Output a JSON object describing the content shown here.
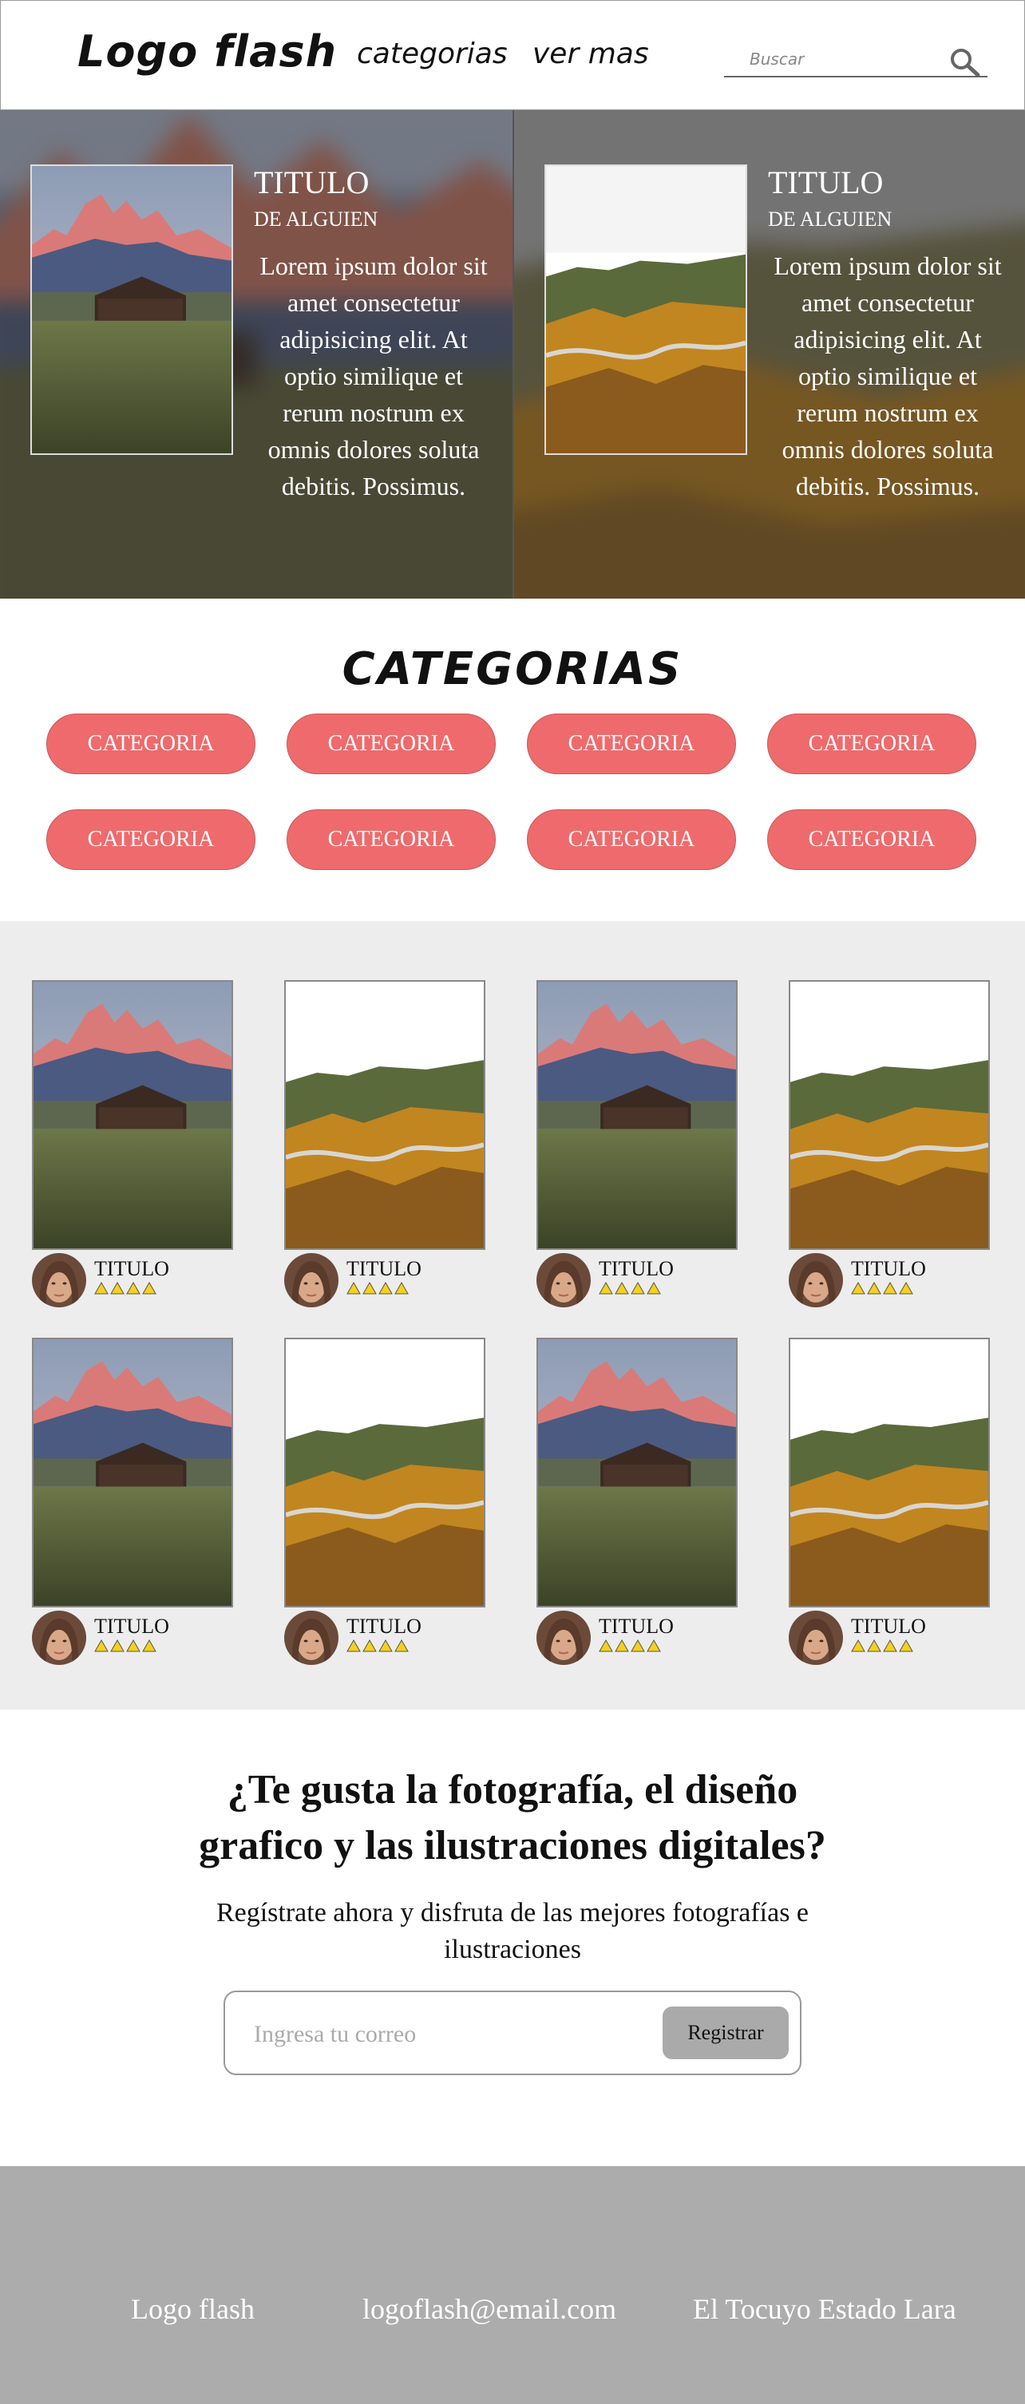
{
  "header": {
    "logo": "Logo flash",
    "nav": [
      "categorias",
      "ver mas"
    ],
    "search_placeholder": "Buscar",
    "search_icon": "search-icon"
  },
  "hero": [
    {
      "title": "TITULO",
      "author": "DE ALGUIEN",
      "description": "Lorem ipsum dolor sit amet consectetur adipisicing elit. At optio similique et rerum nostrum ex omnis dolores soluta debitis. Possimus.",
      "image": "mountain-barn"
    },
    {
      "title": "TITULO",
      "author": "DE ALGUIEN",
      "description": "Lorem ipsum dolor sit amet consectetur adipisicing elit. At optio similique et rerum nostrum ex omnis dolores soluta debitis. Possimus.",
      "image": "autumn-valley-road"
    }
  ],
  "categories": {
    "title": "CATEGORIAS",
    "buttons": [
      "CATEGORIA",
      "CATEGORIA",
      "CATEGORIA",
      "CATEGORIA",
      "CATEGORIA",
      "CATEGORIA",
      "CATEGORIA",
      "CATEGORIA"
    ],
    "button_color": "#ef6a6c"
  },
  "gallery": {
    "background": "#ededed",
    "cards": [
      {
        "title": "TITULO",
        "image": "mountain-barn",
        "rating": 4
      },
      {
        "title": "TITULO",
        "image": "autumn-valley-road",
        "rating": 4
      },
      {
        "title": "TITULO",
        "image": "mountain-barn",
        "rating": 4
      },
      {
        "title": "TITULO",
        "image": "autumn-valley-road",
        "rating": 4
      },
      {
        "title": "TITULO",
        "image": "mountain-barn",
        "rating": 4
      },
      {
        "title": "TITULO",
        "image": "autumn-valley-road",
        "rating": 4
      },
      {
        "title": "TITULO",
        "image": "mountain-barn",
        "rating": 4
      },
      {
        "title": "TITULO",
        "image": "autumn-valley-road",
        "rating": 4
      }
    ]
  },
  "signup": {
    "title_line1": "¿Te gusta la fotografía, el diseño",
    "title_line2": "grafico y las ilustraciones digitales?",
    "subtitle_line1": "Regístrate ahora y disfruta de las mejores fotografías e",
    "subtitle_line2": "ilustraciones",
    "email_placeholder": "Ingresa tu correo",
    "button_label": "Registrar"
  },
  "footer": {
    "logo": "Logo flash",
    "email": "logoflash@email.com",
    "location": "El Tocuyo Estado Lara",
    "background": "#acacac"
  }
}
